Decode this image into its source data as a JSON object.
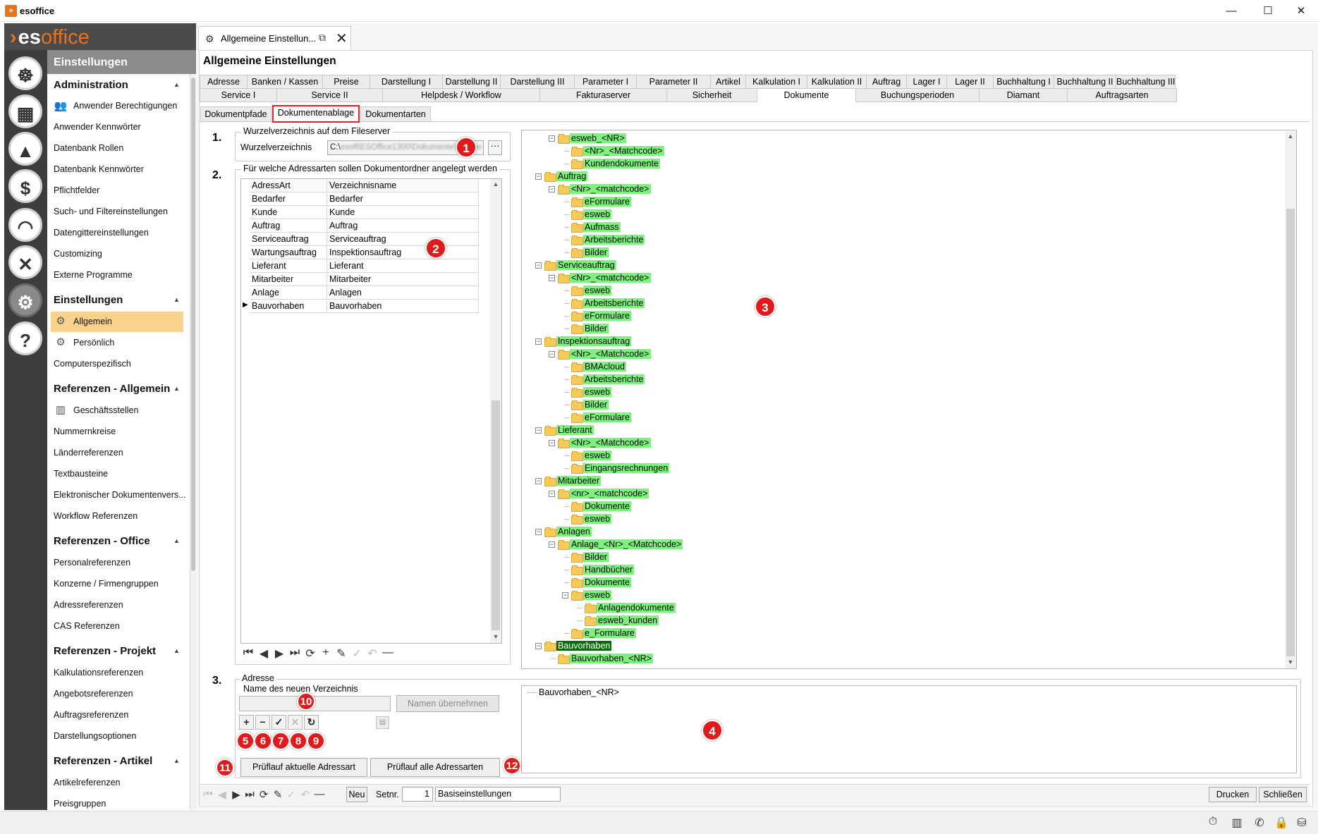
{
  "window": {
    "title": "esoffice",
    "minimize": "—",
    "maximize": "☐",
    "close": "✕"
  },
  "logo": {
    "prefix": "es",
    "suffix": "office"
  },
  "nav": {
    "header": "Einstellungen",
    "sections": [
      {
        "title": "Administration",
        "items": [
          "Anwender Berechtigungen",
          "Anwender Kennwörter",
          "Datenbank Rollen",
          "Datenbank Kennwörter",
          "Pflichtfelder",
          "Such- und Filtereinstellungen",
          "Datengittereinstellungen",
          "Customizing",
          "Externe Programme"
        ]
      },
      {
        "title": "Einstellungen",
        "items": [
          "Allgemein",
          "Persönlich",
          "Computerspezifisch"
        ]
      },
      {
        "title": "Referenzen - Allgemein",
        "items": [
          "Geschäftsstellen",
          "Nummernkreise",
          "Länderreferenzen",
          "Textbausteine",
          "Elektronischer Dokumentenvers...",
          "Workflow Referenzen"
        ]
      },
      {
        "title": "Referenzen - Office",
        "items": [
          "Personalreferenzen",
          "Konzerne / Firmengruppen",
          "Adressreferenzen",
          "CAS Referenzen"
        ]
      },
      {
        "title": "Referenzen - Projekt",
        "items": [
          "Kalkulationsreferenzen",
          "Angebotsreferenzen",
          "Auftragsreferenzen",
          "Darstellungsoptionen"
        ]
      },
      {
        "title": "Referenzen - Artikel",
        "items": [
          "Artikelreferenzen",
          "Preisgruppen"
        ]
      }
    ],
    "selected": "Allgemein"
  },
  "doc_tab": {
    "label": "Allgemeine Einstellun...",
    "close": "✕"
  },
  "page_title": "Allgemeine Einstellungen",
  "tabs_row1": [
    "Adresse",
    "Banken / Kassen",
    "Preise",
    "Darstellung I",
    "Darstellung II",
    "Darstellung III",
    "Parameter I",
    "Parameter II",
    "Artikel",
    "Kalkulation I",
    "Kalkulation II",
    "Auftrag",
    "Lager I",
    "Lager II",
    "Buchhaltung I",
    "Buchhaltung II",
    "Buchhaltung III"
  ],
  "tabs_row2": [
    "Service I",
    "Service II",
    "Helpdesk / Workflow",
    "Fakturaserver",
    "Sicherheit",
    "Dokumente",
    "Buchungsperioden",
    "Diamant",
    "Auftragsarten"
  ],
  "tabs_row2_selected": "Dokumente",
  "subtabs": [
    "Dokumentpfade",
    "Dokumentenablage",
    "Dokumentarten"
  ],
  "subtabs_selected": "Dokumentenablage",
  "section1": {
    "num": "1.",
    "legend": "Wurzelverzeichnis auf dem Fileserver",
    "label": "Wurzelverzeichnis",
    "value_prefix": "C:\\",
    "value_blurred": "esoft\\ESOffice1300\\Dokumente\\Ablage",
    "browse": "···"
  },
  "section2": {
    "num": "2.",
    "legend": "Für welche Adressarten sollen Dokumentordner angelegt werden",
    "columns": [
      "AdressArt",
      "Verzeichnisname"
    ],
    "rows": [
      [
        "Bedarfer",
        "Bedarfer"
      ],
      [
        "Kunde",
        "Kunde"
      ],
      [
        "Auftrag",
        "Auftrag"
      ],
      [
        "Serviceauftrag",
        "Serviceauftrag"
      ],
      [
        "Wartungsauftrag",
        "Inspektionsauftrag"
      ],
      [
        "Lieferant",
        "Lieferant"
      ],
      [
        "Mitarbeiter",
        "Mitarbeiter"
      ],
      [
        "Anlage",
        "Anlagen"
      ],
      [
        "Bauvorhaben",
        "Bauvorhaben"
      ]
    ],
    "current_row": "Bauvorhaben",
    "toolbar": [
      "⏮",
      "◀",
      "▶",
      "⏭",
      "⟳",
      "+",
      "✎",
      "✓",
      "↶",
      "—"
    ]
  },
  "tree": [
    {
      "label": "esweb_<NR>",
      "depth": 1
    },
    {
      "label": "<Nr>_<Matchcode>",
      "depth": 2
    },
    {
      "label": "Kundendokumente",
      "depth": 2
    },
    {
      "label": "Auftrag",
      "depth": 0
    },
    {
      "label": "<Nr>_<matchcode>",
      "depth": 1
    },
    {
      "label": "eFormulare",
      "depth": 2
    },
    {
      "label": "esweb",
      "depth": 2
    },
    {
      "label": "Aufmass",
      "depth": 2
    },
    {
      "label": "Arbeitsberichte",
      "depth": 2
    },
    {
      "label": "Bilder",
      "depth": 2
    },
    {
      "label": "Serviceauftrag",
      "depth": 0
    },
    {
      "label": "<Nr>_<matchcode>",
      "depth": 1
    },
    {
      "label": "esweb",
      "depth": 2
    },
    {
      "label": "Arbeitsberichte",
      "depth": 2
    },
    {
      "label": "eFormulare",
      "depth": 2
    },
    {
      "label": "Bilder",
      "depth": 2
    },
    {
      "label": "Inspektionsauftrag",
      "depth": 0
    },
    {
      "label": "<Nr>_<Matchcode>",
      "depth": 1
    },
    {
      "label": "BMAcloud",
      "depth": 2
    },
    {
      "label": "Arbeitsberichte",
      "depth": 2
    },
    {
      "label": "esweb",
      "depth": 2
    },
    {
      "label": "Bilder",
      "depth": 2
    },
    {
      "label": "eFormulare",
      "depth": 2
    },
    {
      "label": "Lieferant",
      "depth": 0
    },
    {
      "label": "<Nr>_<Matchcode>",
      "depth": 1
    },
    {
      "label": "esweb",
      "depth": 2
    },
    {
      "label": "Eingangsrechnungen",
      "depth": 2
    },
    {
      "label": "Mitarbeiter",
      "depth": 0
    },
    {
      "label": "<nr>_<matchcode>",
      "depth": 1
    },
    {
      "label": "Dokumente",
      "depth": 2
    },
    {
      "label": "esweb",
      "depth": 2
    },
    {
      "label": "Anlagen",
      "depth": 0
    },
    {
      "label": "Anlage_<Nr>_<Matchcode>",
      "depth": 1
    },
    {
      "label": "Bilder",
      "depth": 2
    },
    {
      "label": "Handbücher",
      "depth": 2
    },
    {
      "label": "Dokumente",
      "depth": 2
    },
    {
      "label": "esweb",
      "depth": 2
    },
    {
      "label": "Anlagendokumente",
      "depth": 3
    },
    {
      "label": "esweb_kunden",
      "depth": 3
    },
    {
      "label": "e_Formulare",
      "depth": 2
    },
    {
      "label": "Bauvorhaben",
      "depth": 0,
      "selected": true
    },
    {
      "label": "Bauvorhaben_<NR>",
      "depth": 1
    }
  ],
  "section3": {
    "num": "3.",
    "legend": "Adresse",
    "new_dir_label": "Name des neuen Verzeichnis",
    "new_dir_value": "",
    "apply_button": "Namen übernehmen",
    "mini_buttons": [
      "+",
      "−",
      "✓",
      "✕",
      "↻"
    ],
    "check_current": "Prüflauf aktuelle Adressart",
    "check_all": "Prüflauf alle Adressarten",
    "preview_node": "Bauvorhaben_<NR>"
  },
  "callouts": [
    "1",
    "2",
    "3",
    "4",
    "5",
    "6",
    "7",
    "8",
    "9",
    "10",
    "11",
    "12"
  ],
  "record_bar": {
    "tools": [
      "⏮",
      "◀",
      "▶",
      "⏭",
      "⟳",
      "✎",
      "✓",
      "↶",
      "—"
    ],
    "new_button": "Neu",
    "setnr_label": "Setnr.",
    "setnr_value": "1",
    "set_name": "Basiseinstellungen",
    "print_button": "Drucken",
    "close_button": "Schließen"
  },
  "status_icons": [
    "stopwatch-icon",
    "building-icon",
    "phone-icon",
    "lock-icon",
    "database-icon"
  ],
  "colors": {
    "accent": "#e8731a",
    "nav_selected": "#fbd28b",
    "tree_highlight": "#7df27d",
    "tree_selected": "#0b6b0b",
    "callout": "#e11b1b"
  }
}
